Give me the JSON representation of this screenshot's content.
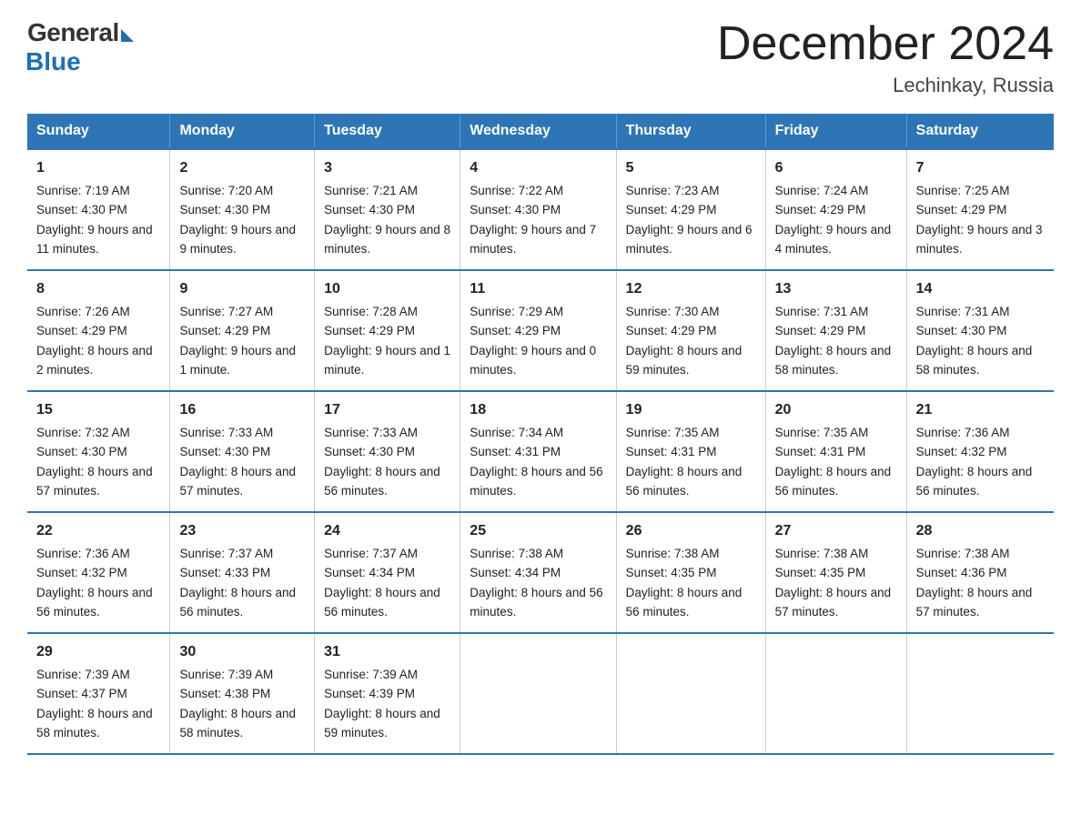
{
  "logo": {
    "general": "General",
    "blue": "Blue"
  },
  "title": "December 2024",
  "subtitle": "Lechinkay, Russia",
  "weekdays": [
    "Sunday",
    "Monday",
    "Tuesday",
    "Wednesday",
    "Thursday",
    "Friday",
    "Saturday"
  ],
  "weeks": [
    [
      {
        "day": "1",
        "sunrise": "7:19 AM",
        "sunset": "4:30 PM",
        "daylight": "9 hours and 11 minutes."
      },
      {
        "day": "2",
        "sunrise": "7:20 AM",
        "sunset": "4:30 PM",
        "daylight": "9 hours and 9 minutes."
      },
      {
        "day": "3",
        "sunrise": "7:21 AM",
        "sunset": "4:30 PM",
        "daylight": "9 hours and 8 minutes."
      },
      {
        "day": "4",
        "sunrise": "7:22 AM",
        "sunset": "4:30 PM",
        "daylight": "9 hours and 7 minutes."
      },
      {
        "day": "5",
        "sunrise": "7:23 AM",
        "sunset": "4:29 PM",
        "daylight": "9 hours and 6 minutes."
      },
      {
        "day": "6",
        "sunrise": "7:24 AM",
        "sunset": "4:29 PM",
        "daylight": "9 hours and 4 minutes."
      },
      {
        "day": "7",
        "sunrise": "7:25 AM",
        "sunset": "4:29 PM",
        "daylight": "9 hours and 3 minutes."
      }
    ],
    [
      {
        "day": "8",
        "sunrise": "7:26 AM",
        "sunset": "4:29 PM",
        "daylight": "8 hours and 2 minutes."
      },
      {
        "day": "9",
        "sunrise": "7:27 AM",
        "sunset": "4:29 PM",
        "daylight": "9 hours and 1 minute."
      },
      {
        "day": "10",
        "sunrise": "7:28 AM",
        "sunset": "4:29 PM",
        "daylight": "9 hours and 1 minute."
      },
      {
        "day": "11",
        "sunrise": "7:29 AM",
        "sunset": "4:29 PM",
        "daylight": "9 hours and 0 minutes."
      },
      {
        "day": "12",
        "sunrise": "7:30 AM",
        "sunset": "4:29 PM",
        "daylight": "8 hours and 59 minutes."
      },
      {
        "day": "13",
        "sunrise": "7:31 AM",
        "sunset": "4:29 PM",
        "daylight": "8 hours and 58 minutes."
      },
      {
        "day": "14",
        "sunrise": "7:31 AM",
        "sunset": "4:30 PM",
        "daylight": "8 hours and 58 minutes."
      }
    ],
    [
      {
        "day": "15",
        "sunrise": "7:32 AM",
        "sunset": "4:30 PM",
        "daylight": "8 hours and 57 minutes."
      },
      {
        "day": "16",
        "sunrise": "7:33 AM",
        "sunset": "4:30 PM",
        "daylight": "8 hours and 57 minutes."
      },
      {
        "day": "17",
        "sunrise": "7:33 AM",
        "sunset": "4:30 PM",
        "daylight": "8 hours and 56 minutes."
      },
      {
        "day": "18",
        "sunrise": "7:34 AM",
        "sunset": "4:31 PM",
        "daylight": "8 hours and 56 minutes."
      },
      {
        "day": "19",
        "sunrise": "7:35 AM",
        "sunset": "4:31 PM",
        "daylight": "8 hours and 56 minutes."
      },
      {
        "day": "20",
        "sunrise": "7:35 AM",
        "sunset": "4:31 PM",
        "daylight": "8 hours and 56 minutes."
      },
      {
        "day": "21",
        "sunrise": "7:36 AM",
        "sunset": "4:32 PM",
        "daylight": "8 hours and 56 minutes."
      }
    ],
    [
      {
        "day": "22",
        "sunrise": "7:36 AM",
        "sunset": "4:32 PM",
        "daylight": "8 hours and 56 minutes."
      },
      {
        "day": "23",
        "sunrise": "7:37 AM",
        "sunset": "4:33 PM",
        "daylight": "8 hours and 56 minutes."
      },
      {
        "day": "24",
        "sunrise": "7:37 AM",
        "sunset": "4:34 PM",
        "daylight": "8 hours and 56 minutes."
      },
      {
        "day": "25",
        "sunrise": "7:38 AM",
        "sunset": "4:34 PM",
        "daylight": "8 hours and 56 minutes."
      },
      {
        "day": "26",
        "sunrise": "7:38 AM",
        "sunset": "4:35 PM",
        "daylight": "8 hours and 56 minutes."
      },
      {
        "day": "27",
        "sunrise": "7:38 AM",
        "sunset": "4:35 PM",
        "daylight": "8 hours and 57 minutes."
      },
      {
        "day": "28",
        "sunrise": "7:38 AM",
        "sunset": "4:36 PM",
        "daylight": "8 hours and 57 minutes."
      }
    ],
    [
      {
        "day": "29",
        "sunrise": "7:39 AM",
        "sunset": "4:37 PM",
        "daylight": "8 hours and 58 minutes."
      },
      {
        "day": "30",
        "sunrise": "7:39 AM",
        "sunset": "4:38 PM",
        "daylight": "8 hours and 58 minutes."
      },
      {
        "day": "31",
        "sunrise": "7:39 AM",
        "sunset": "4:39 PM",
        "daylight": "8 hours and 59 minutes."
      },
      null,
      null,
      null,
      null
    ]
  ],
  "sunrise_label": "Sunrise:",
  "sunset_label": "Sunset:",
  "daylight_label": "Daylight:"
}
